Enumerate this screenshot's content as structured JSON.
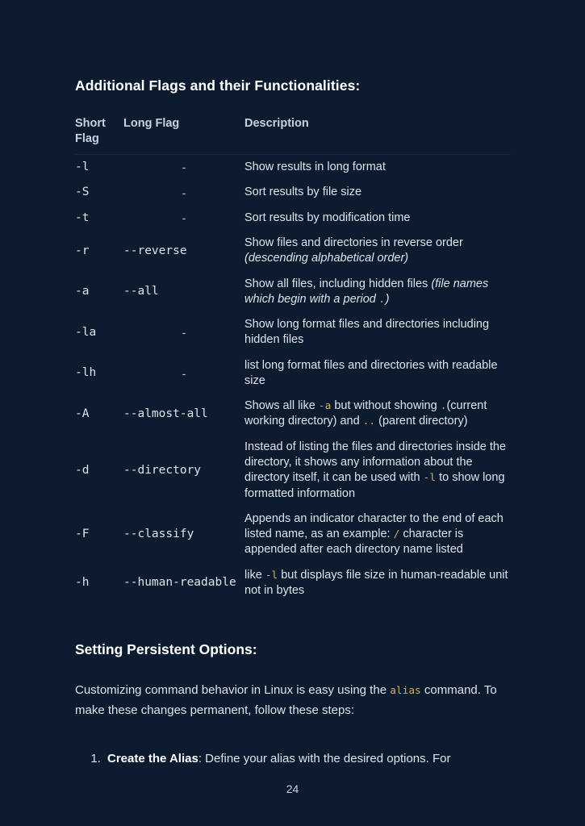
{
  "document": {
    "page_number": "24",
    "background_color": "#0c1c2e",
    "code_color": "#d3ab6e",
    "text_color": "#dde3ec"
  },
  "flags_section": {
    "title": "Additional Flags and their Functionalities:",
    "table": {
      "headers": {
        "short_flag": "Short Flag",
        "long_flag": "Long Flag",
        "description": "Description"
      },
      "rows": [
        {
          "short": "-l",
          "long": "-",
          "long_is_dash": true,
          "desc_plain": "Show results in long format"
        },
        {
          "short": "-S",
          "long": "-",
          "long_is_dash": true,
          "desc_plain": "Sort results by file size"
        },
        {
          "short": "-t",
          "long": "-",
          "long_is_dash": true,
          "desc_plain": "Sort results by modification time"
        },
        {
          "short": "-r",
          "long": "--reverse",
          "long_is_dash": false,
          "desc_html": "Show files and directories in reverse order <em class=\"it\">(descending alphabetical order)</em>"
        },
        {
          "short": "-a",
          "long": "--all",
          "long_is_dash": false,
          "desc_html": "Show all files, including hidden files <em class=\"it\">(file names which begin with a period <code class=\"inl\">.</code>)</em>"
        },
        {
          "short": "-la",
          "long": "-",
          "long_is_dash": true,
          "desc_plain": "Show long format files and directories including hidden files"
        },
        {
          "short": "-lh",
          "long": "-",
          "long_is_dash": true,
          "desc_plain": "list long format files and directories with readable size"
        },
        {
          "short": "-A",
          "long": "--almost-all",
          "long_is_dash": false,
          "desc_html": "Shows all like <code class=\"inl\">-a</code> but without showing <code class=\"inl\">.</code>(current working directory) and <code class=\"inl\">..</code> (parent directory)"
        },
        {
          "short": "-d",
          "long": "--directory",
          "long_is_dash": false,
          "desc_html": "Instead of listing the files and directories inside the directory, it shows any information about the directory itself, it can be used with <code class=\"inl\">-l</code> to show long formatted information"
        },
        {
          "short": "-F",
          "long": "--classify",
          "long_is_dash": false,
          "desc_html": "Appends an indicator character to the end of each listed name, as an example: <code class=\"inl\">/</code> character is appended after each directory name listed"
        },
        {
          "short": "-h",
          "long": "--human-readable",
          "long_is_dash": false,
          "desc_html": "like <code class=\"inl\">-l</code> but displays file size in human-readable unit not in bytes"
        }
      ]
    }
  },
  "persistent_section": {
    "title": "Setting Persistent Options:",
    "paragraph_html": "Customizing command behavior in Linux is easy using the <code class=\"inl\">alias</code> command. To make these changes permanent, follow these steps:",
    "steps": [
      {
        "html": "<b>Create the Alias</b>: Define your alias with the desired options. For"
      }
    ]
  }
}
